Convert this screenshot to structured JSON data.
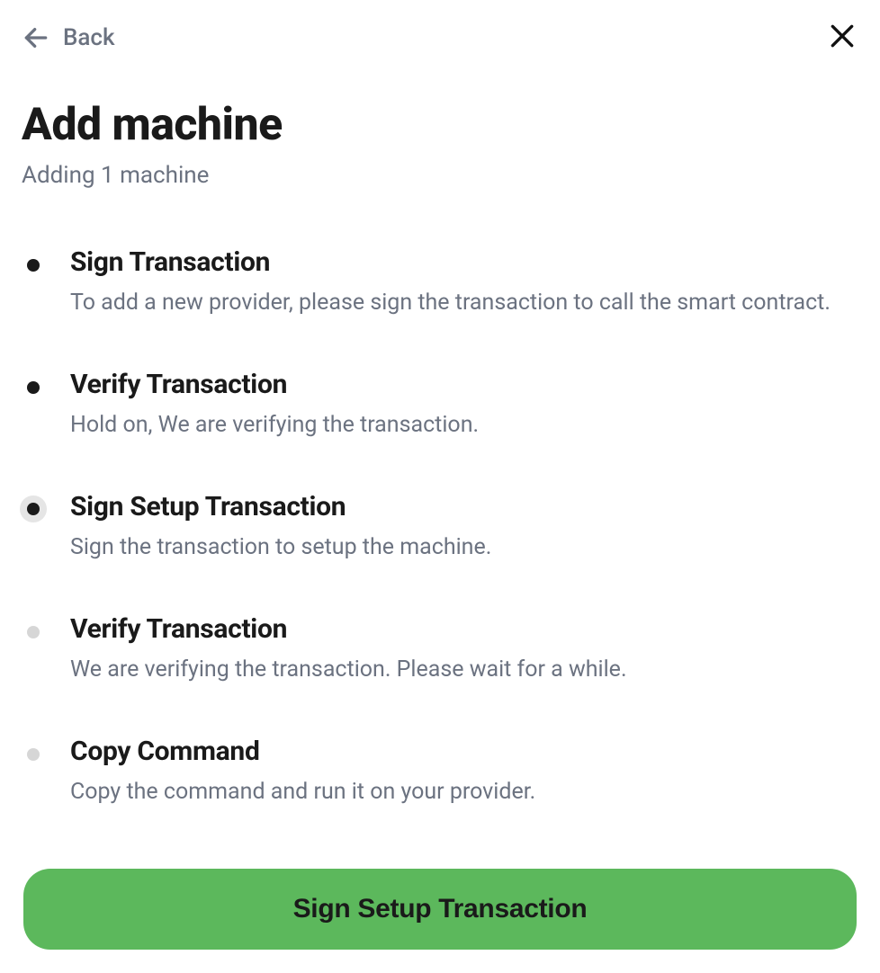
{
  "header": {
    "back_label": "Back"
  },
  "title": "Add machine",
  "subtitle": "Adding 1 machine",
  "steps": [
    {
      "title": "Sign Transaction",
      "description": "To add a new provider, please sign the transaction to call the smart contract.",
      "status": "completed"
    },
    {
      "title": "Verify Transaction",
      "description": "Hold on, We are verifying the transaction.",
      "status": "completed"
    },
    {
      "title": "Sign Setup Transaction",
      "description": "Sign the transaction to setup the machine.",
      "status": "active"
    },
    {
      "title": "Verify Transaction",
      "description": "We are verifying the transaction. Please wait for a while.",
      "status": "pending"
    },
    {
      "title": "Copy Command",
      "description": "Copy the command and run it on your provider.",
      "status": "pending"
    }
  ],
  "action_button_label": "Sign Setup Transaction",
  "colors": {
    "primary_green": "#5cb85c",
    "text_dark": "#1a1a1a",
    "text_muted": "#6b7280"
  }
}
